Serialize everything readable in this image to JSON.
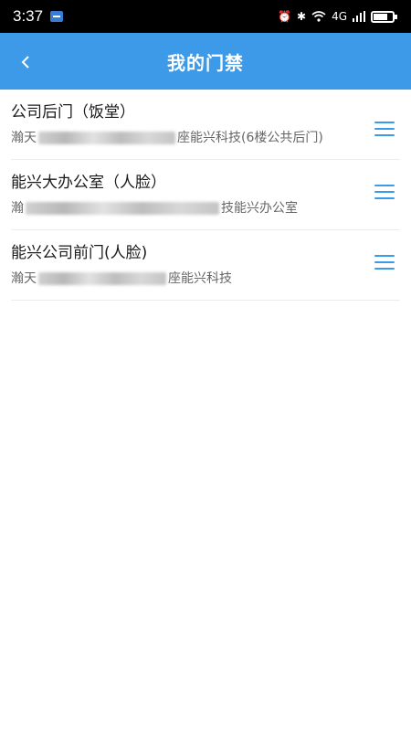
{
  "status_bar": {
    "time": "3:37",
    "network": "4G"
  },
  "header": {
    "title": "我的门禁"
  },
  "doors": [
    {
      "name": "公司后门（饭堂）",
      "address_prefix": "瀚天",
      "address_suffix": "座能兴科技(6楼公共后门)"
    },
    {
      "name": "能兴大办公室（人脸）",
      "address_prefix": "瀚",
      "address_suffix": "技能兴办公室"
    },
    {
      "name": "能兴公司前门(人脸)",
      "address_prefix": "瀚天",
      "address_suffix": "座能兴科技"
    }
  ],
  "colors": {
    "accent": "#3d9ae8",
    "status_bar": "#000000"
  }
}
